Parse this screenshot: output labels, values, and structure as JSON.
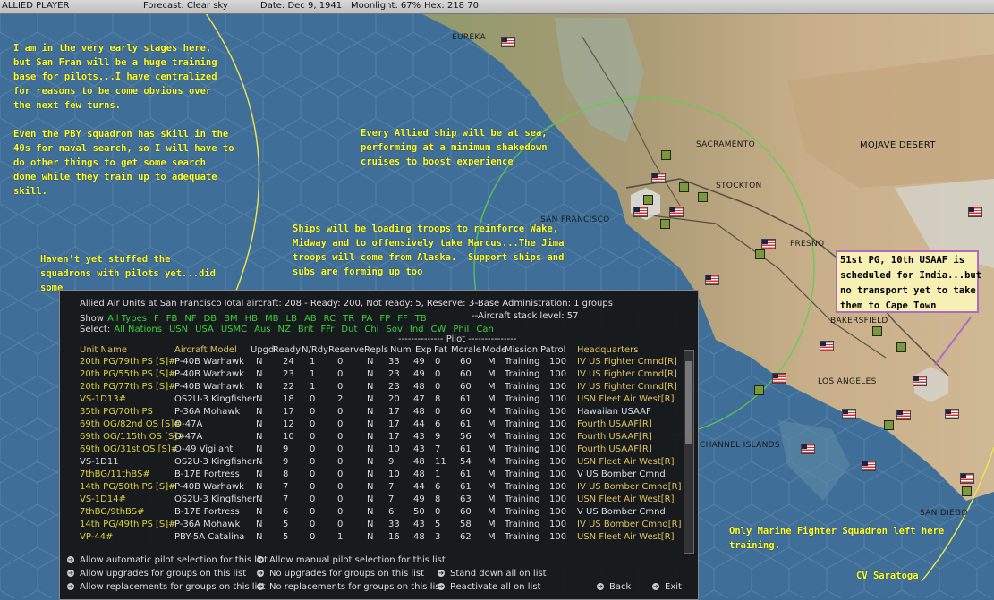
{
  "topbar": {
    "player": "ALLIED PLAYER",
    "forecast": "Forecast: Clear sky",
    "date": "Date: Dec 9, 1941",
    "moonlight": "Moonlight: 67%",
    "hex": "Hex: 218 70"
  },
  "notes": {
    "n1": "I am in the very early stages here,\nbut San Fran will be a huge training\nbase for pilots...I have centralized\nfor reasons to be come obvious over\nthe next few turns.\n\nEven the PBY squadron has skill in the\n40s for naval search, so I will have to\ndo other things to get some search\ndone while they train up to adequate\nskill.",
    "n2": "Every Allied ship will be at sea,\nperforming at a minimum shakedown\ncruises to boost experience",
    "n3": "Ships will be loading troops to reinforce Wake,\nMidway and to offensively take Marcus...The Jima\ntroops will come from Alaska.  Support ships and\nsubs are forming up too",
    "n4": "Haven't yet stuffed the\nsquadrons with pilots yet...did\nsome",
    "n5": "Only Marine Fighter Squadron left here\ntraining.",
    "n6": "CV Saratoga",
    "callout": "51st PG, 10th USAAF is\nscheduled for India...but\nno transport yet to take\nthem to Cape Town"
  },
  "map_labels": {
    "eureka": "EUREKA",
    "sacramento": "SACRAMENTO",
    "stockton": "STOCKTON",
    "san_francisco": "SAN FRANCISCO",
    "fresno": "FRESNO",
    "mojave": "MOJAVE DESERT",
    "bakersfield": "BAKERSFIELD",
    "los_angeles": "LOS ANGELES",
    "channel_islands": "CHANNEL ISLANDS",
    "san_diego": "SAN DIEGO"
  },
  "panel": {
    "title": "Allied Air Units at San Francisco",
    "total": "Total aircraft: 208 - Ready: 200, Not ready: 5, Reserve: 3",
    "base_admin": "--Base Administration: 1 groups",
    "stack": "--Aircraft stack level: 57",
    "show_label": "Show",
    "show_items": [
      "All Types",
      "F",
      "FB",
      "NF",
      "DB",
      "BM",
      "HB",
      "MB",
      "LB",
      "AB",
      "RC",
      "TR",
      "PA",
      "FP",
      "FF",
      "TB"
    ],
    "select_label": "Select:",
    "select_items": [
      "All Nations",
      "USN",
      "USA",
      "USMC",
      "Aus",
      "NZ",
      "Brit",
      "FFr",
      "Dut",
      "Chi",
      "Sov",
      "Ind",
      "CW",
      "Phil",
      "Can"
    ],
    "pilot_header": "-------------- Pilot ---------------",
    "columns": [
      "Unit Name",
      "Aircraft Model",
      "Upgd",
      "Ready",
      "N/Rdy",
      "Reserve",
      "Repls",
      "Num",
      "Exp",
      "Fat",
      "Morale",
      "Mode",
      "Mission",
      "Patrol",
      "Headquarters"
    ],
    "rows": [
      {
        "unit": "20th PG/79th PS [S]#",
        "model": "P-40B Warhawk",
        "upgd": "N",
        "ready": "24",
        "nrdy": "1",
        "reserve": "0",
        "repls": "N",
        "num": "33",
        "exp": "49",
        "fat": "0",
        "morale": "60",
        "mode": "M",
        "mission": "Training",
        "patrol": "100",
        "hq": "IV US Fighter Cmnd[R]",
        "yellow": true
      },
      {
        "unit": "20th PG/55th PS [S]#",
        "model": "P-40B Warhawk",
        "upgd": "N",
        "ready": "23",
        "nrdy": "1",
        "reserve": "0",
        "repls": "N",
        "num": "23",
        "exp": "49",
        "fat": "0",
        "morale": "60",
        "mode": "M",
        "mission": "Training",
        "patrol": "100",
        "hq": "IV US Fighter Cmnd[R]",
        "yellow": true
      },
      {
        "unit": "20th PG/77th PS [S]#",
        "model": "P-40B Warhawk",
        "upgd": "N",
        "ready": "22",
        "nrdy": "1",
        "reserve": "0",
        "repls": "N",
        "num": "23",
        "exp": "48",
        "fat": "0",
        "morale": "60",
        "mode": "M",
        "mission": "Training",
        "patrol": "100",
        "hq": "IV US Fighter Cmnd[R]",
        "yellow": true
      },
      {
        "unit": "VS-1D13#",
        "model": "OS2U-3 Kingfisher",
        "upgd": "N",
        "ready": "18",
        "nrdy": "0",
        "reserve": "2",
        "repls": "N",
        "num": "20",
        "exp": "47",
        "fat": "8",
        "morale": "61",
        "mode": "M",
        "mission": "Training",
        "patrol": "100",
        "hq": "USN Fleet Air West[R]",
        "yellow": true
      },
      {
        "unit": "35th PG/70th PS",
        "model": "P-36A Mohawk",
        "upgd": "N",
        "ready": "17",
        "nrdy": "0",
        "reserve": "0",
        "repls": "N",
        "num": "17",
        "exp": "48",
        "fat": "0",
        "morale": "60",
        "mode": "M",
        "mission": "Training",
        "patrol": "100",
        "hq": "Hawaiian USAAF",
        "yellow": true
      },
      {
        "unit": "69th OG/82nd OS [S]#",
        "model": "O-47A",
        "upgd": "N",
        "ready": "12",
        "nrdy": "0",
        "reserve": "0",
        "repls": "N",
        "num": "17",
        "exp": "44",
        "fat": "6",
        "morale": "61",
        "mode": "M",
        "mission": "Training",
        "patrol": "100",
        "hq": "Fourth USAAF[R]",
        "yellow": true
      },
      {
        "unit": "69th OG/115th OS [S]#",
        "model": "O-47A",
        "upgd": "N",
        "ready": "10",
        "nrdy": "0",
        "reserve": "0",
        "repls": "N",
        "num": "17",
        "exp": "43",
        "fat": "9",
        "morale": "56",
        "mode": "M",
        "mission": "Training",
        "patrol": "100",
        "hq": "Fourth USAAF[R]",
        "yellow": true
      },
      {
        "unit": "69th OG/31st OS [S]#",
        "model": "O-49 Vigilant",
        "upgd": "N",
        "ready": "9",
        "nrdy": "0",
        "reserve": "0",
        "repls": "N",
        "num": "10",
        "exp": "43",
        "fat": "7",
        "morale": "61",
        "mode": "M",
        "mission": "Training",
        "patrol": "100",
        "hq": "Fourth USAAF[R]",
        "yellow": true
      },
      {
        "unit": "VS-1D11",
        "model": "OS2U-3 Kingfisher",
        "upgd": "N",
        "ready": "9",
        "nrdy": "0",
        "reserve": "0",
        "repls": "N",
        "num": "9",
        "exp": "48",
        "fat": "11",
        "morale": "54",
        "mode": "M",
        "mission": "Training",
        "patrol": "100",
        "hq": "USN Fleet Air West[R]",
        "yellow": false
      },
      {
        "unit": "7thBG/11thBS#",
        "model": "B-17E Fortress",
        "upgd": "N",
        "ready": "8",
        "nrdy": "0",
        "reserve": "0",
        "repls": "N",
        "num": "10",
        "exp": "48",
        "fat": "1",
        "morale": "61",
        "mode": "M",
        "mission": "Training",
        "patrol": "100",
        "hq": "V US Bomber Cmnd",
        "yellow": true
      },
      {
        "unit": "14th PG/50th PS [S]#",
        "model": "P-40B Warhawk",
        "upgd": "N",
        "ready": "7",
        "nrdy": "0",
        "reserve": "0",
        "repls": "N",
        "num": "7",
        "exp": "44",
        "fat": "6",
        "morale": "61",
        "mode": "M",
        "mission": "Training",
        "patrol": "100",
        "hq": "IV US Bomber Cmnd[R]",
        "yellow": true
      },
      {
        "unit": "VS-1D14#",
        "model": "OS2U-3 Kingfisher",
        "upgd": "N",
        "ready": "7",
        "nrdy": "0",
        "reserve": "0",
        "repls": "N",
        "num": "7",
        "exp": "49",
        "fat": "8",
        "morale": "63",
        "mode": "M",
        "mission": "Training",
        "patrol": "100",
        "hq": "USN Fleet Air West[R]",
        "yellow": true
      },
      {
        "unit": "7thBG/9thBS#",
        "model": "B-17E Fortress",
        "upgd": "N",
        "ready": "6",
        "nrdy": "0",
        "reserve": "0",
        "repls": "N",
        "num": "6",
        "exp": "50",
        "fat": "0",
        "morale": "60",
        "mode": "M",
        "mission": "Training",
        "patrol": "100",
        "hq": "V US Bomber Cmnd",
        "yellow": true
      },
      {
        "unit": "14th PG/49th PS [S]#",
        "model": "P-36A Mohawk",
        "upgd": "N",
        "ready": "5",
        "nrdy": "0",
        "reserve": "0",
        "repls": "N",
        "num": "33",
        "exp": "43",
        "fat": "5",
        "morale": "58",
        "mode": "M",
        "mission": "Training",
        "patrol": "100",
        "hq": "IV US Bomber Cmnd[R]",
        "yellow": true
      },
      {
        "unit": "VP-44#",
        "model": "PBY-5A Catalina",
        "upgd": "N",
        "ready": "5",
        "nrdy": "0",
        "reserve": "1",
        "repls": "N",
        "num": "16",
        "exp": "48",
        "fat": "3",
        "morale": "62",
        "mode": "M",
        "mission": "Training",
        "patrol": "100",
        "hq": "USN Fleet Air West[R]",
        "yellow": true
      }
    ],
    "options": {
      "auto_pilot": "Allow automatic pilot selection for this list",
      "manual_pilot": "Allow manual pilot selection for this list",
      "allow_upgrades": "Allow upgrades for groups on this list",
      "no_upgrades": "No upgrades for groups on this list",
      "stand_down": "Stand down all on list",
      "allow_repl": "Allow replacements for groups on this list",
      "no_repl": "No replacements for groups on this list",
      "reactivate": "Reactivate all on list",
      "back": "Back",
      "exit": "Exit"
    }
  }
}
